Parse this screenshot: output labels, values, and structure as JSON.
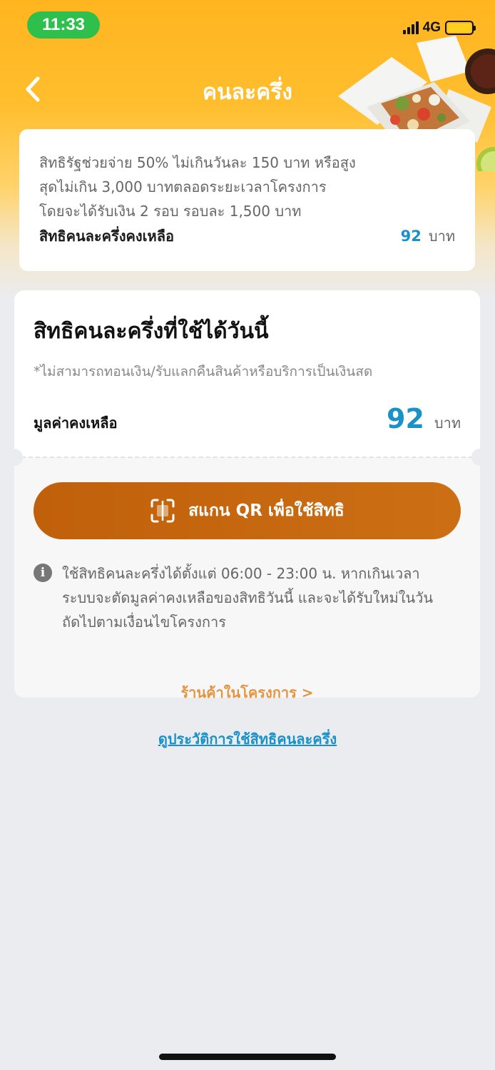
{
  "status_bar": {
    "time": "11:33",
    "network": "4G",
    "battery_color": "#ffcf1e"
  },
  "header": {
    "title": "คนละครึ่ง",
    "back_icon": "chevron-left-icon"
  },
  "summary": {
    "line1": "สิทธิรัฐช่วยจ่าย 50% ไม่เกินวันละ 150 บาท หรือสูง",
    "line2": "สุดไม่เกิน 3,000 บาทตลอดระยะเวลาโครงการ",
    "line3": "โดยจะได้รับเงิน 2 รอบ รอบละ 1,500 บาท",
    "remaining_label": "สิทธิคนละครึ่งคงเหลือ",
    "remaining_amount": "92",
    "unit": "บาท"
  },
  "today": {
    "title": "สิทธิคนละครึ่งที่ใช้ได้วันนี้",
    "note": "*ไม่สามารถทอนเงิน/รับแลกคืนสินค้าหรือบริการเป็นเงินสด",
    "balance_label": "มูลค่าคงเหลือ",
    "balance_amount": "92",
    "unit": "บาท",
    "scan_button": "สแกน QR เพื่อใช้สิทธิ",
    "notice_line1": "ใช้สิทธิคนละครึ่งได้ตั้งแต่ 06:00 - 23:00 น. หากเกินเวลา",
    "notice_line2": "ระบบจะตัดมูลค่าคงเหลือของสิทธิวันนี้ และจะได้รับใหม่ในวัน",
    "notice_line3": "ถัดไปตามเงื่อนไขโครงการ",
    "shops_link": "ร้านค้าในโครงการ >"
  },
  "history_link": "ดูประวัติการใช้สิทธิคนละครึ่ง",
  "colors": {
    "accent_blue": "#1a91c7",
    "scan_orange": "#c0600b",
    "link_orange": "#e59440",
    "header_yellow": "#ffb51f"
  }
}
